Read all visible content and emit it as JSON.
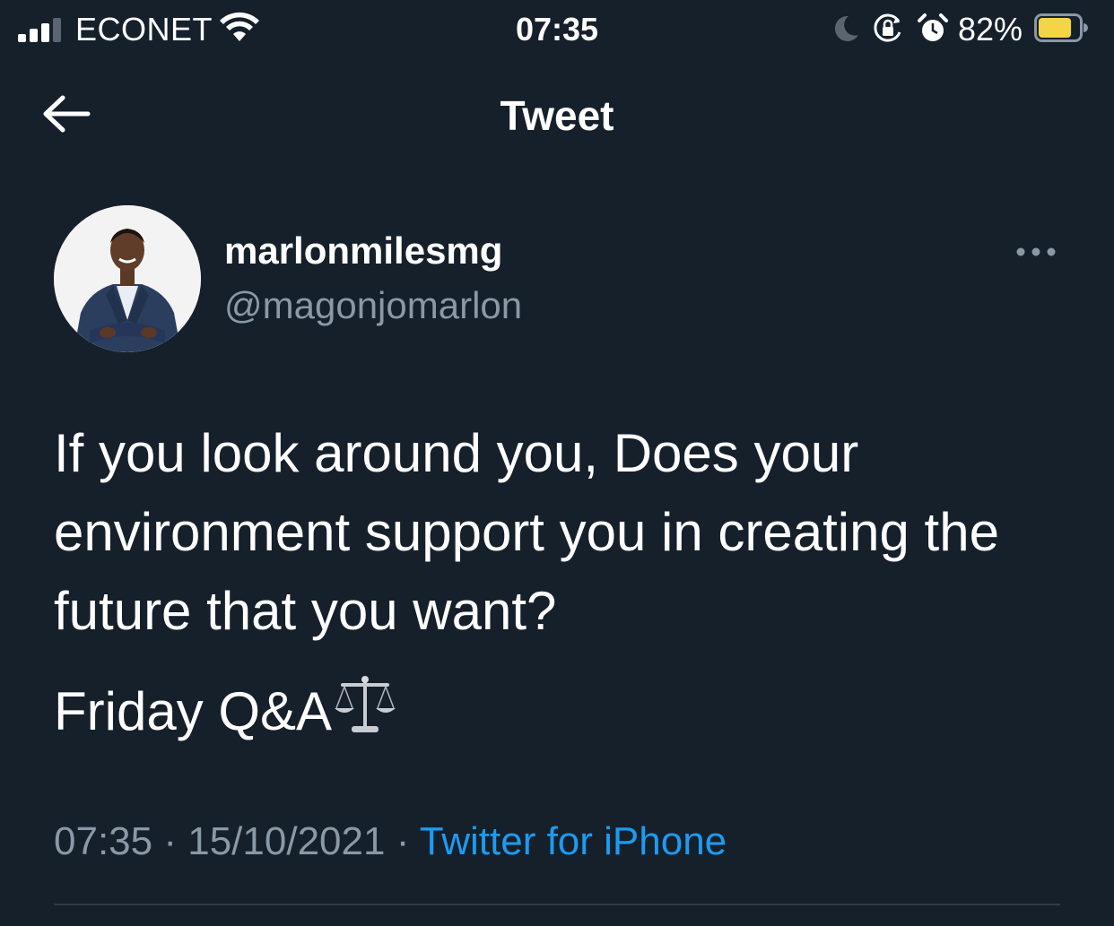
{
  "status_bar": {
    "carrier": "ECONET",
    "time": "07:35",
    "battery_percent": "82%",
    "icons": [
      "signal-bars-icon",
      "wifi-icon",
      "moon-icon",
      "orientation-lock-icon",
      "alarm-icon",
      "battery-icon"
    ],
    "battery_level": 0.82,
    "battery_color": "#f5d547"
  },
  "nav": {
    "back_icon": "back-arrow-icon",
    "title": "Tweet"
  },
  "tweet": {
    "author": {
      "display_name": "marlonmilesmg",
      "handle": "@magonjomarlon",
      "avatar": "profile-photo"
    },
    "more_icon": "more-options-icon",
    "text_paragraph_1": "If you look around you, Does your environment support you in creating the future that you want?",
    "text_paragraph_2": "Friday Q&A",
    "emoji": "balance-scale-emoji",
    "time": "07:35",
    "separator": "·",
    "date": "15/10/2021",
    "source": "Twitter for iPhone"
  },
  "colors": {
    "background": "#15202b",
    "text_primary": "#ffffff",
    "text_secondary": "#8b98a5",
    "link": "#1d9bf0",
    "divider": "#2f3a45"
  }
}
